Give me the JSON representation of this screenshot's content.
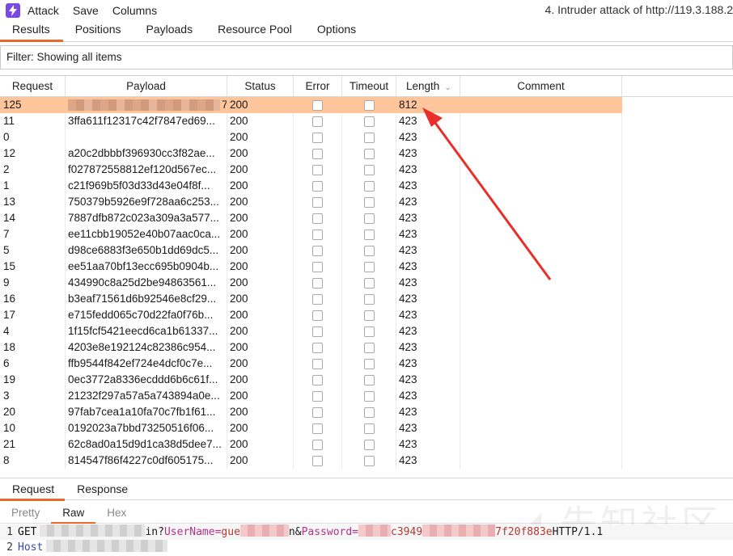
{
  "menu": {
    "items": [
      "Attack",
      "Save",
      "Columns"
    ],
    "window_title": "4. Intruder attack of http://119.3.188.2"
  },
  "tabs": [
    "Results",
    "Positions",
    "Payloads",
    "Resource Pool",
    "Options"
  ],
  "filter": {
    "text": "Filter: Showing all items"
  },
  "table": {
    "columns": [
      "Request",
      "Payload",
      "Status",
      "Error",
      "Timeout",
      "Length",
      "Comment"
    ],
    "rows": [
      {
        "request": "125",
        "payload": "7...",
        "status": "200",
        "length": "812",
        "selected": true
      },
      {
        "request": "11",
        "payload": "3ffa611f12317c42f7847ed69...",
        "status": "200",
        "length": "423"
      },
      {
        "request": "0",
        "payload": "",
        "status": "200",
        "length": "423"
      },
      {
        "request": "12",
        "payload": "a20c2dbbbf396930cc3f82ae...",
        "status": "200",
        "length": "423"
      },
      {
        "request": "2",
        "payload": "f027872558812ef120d567ec...",
        "status": "200",
        "length": "423"
      },
      {
        "request": "1",
        "payload": "c21f969b5f03d33d43e04f8f...",
        "status": "200",
        "length": "423"
      },
      {
        "request": "13",
        "payload": "750379b5926e9f728aa6c253...",
        "status": "200",
        "length": "423"
      },
      {
        "request": "14",
        "payload": "7887dfb872c023a309a3a577...",
        "status": "200",
        "length": "423"
      },
      {
        "request": "7",
        "payload": "ee11cbb19052e40b07aac0ca...",
        "status": "200",
        "length": "423"
      },
      {
        "request": "5",
        "payload": "d98ce6883f3e650b1dd69dc5...",
        "status": "200",
        "length": "423"
      },
      {
        "request": "15",
        "payload": "ee51aa70bf13ecc695b0904b...",
        "status": "200",
        "length": "423"
      },
      {
        "request": "9",
        "payload": "434990c8a25d2be94863561...",
        "status": "200",
        "length": "423"
      },
      {
        "request": "16",
        "payload": "b3eaf71561d6b92546e8cf29...",
        "status": "200",
        "length": "423"
      },
      {
        "request": "17",
        "payload": "e715fedd065c70d22fa0f76b...",
        "status": "200",
        "length": "423"
      },
      {
        "request": "4",
        "payload": "1f15fcf5421eecd6ca1b61337...",
        "status": "200",
        "length": "423"
      },
      {
        "request": "18",
        "payload": "4203e8e192124c82386c954...",
        "status": "200",
        "length": "423"
      },
      {
        "request": "6",
        "payload": "ffb9544f842ef724e4dcf0c7e...",
        "status": "200",
        "length": "423"
      },
      {
        "request": "19",
        "payload": "0ec3772a8336ecddd6b6c61f...",
        "status": "200",
        "length": "423"
      },
      {
        "request": "3",
        "payload": "21232f297a57a5a743894a0e...",
        "status": "200",
        "length": "423"
      },
      {
        "request": "20",
        "payload": "97fab7cea1a10fa70c7fb1f61...",
        "status": "200",
        "length": "423"
      },
      {
        "request": "10",
        "payload": "0192023a7bbd73250516f06...",
        "status": "200",
        "length": "423"
      },
      {
        "request": "21",
        "payload": "62c8ad0a15d9d1ca38d5dee7...",
        "status": "200",
        "length": "423"
      },
      {
        "request": "8",
        "payload": "814547f86f4227c0df605175...",
        "status": "200",
        "length": "423"
      }
    ]
  },
  "bottom_tabs": [
    "Request",
    "Response"
  ],
  "view_tabs": [
    "Pretty",
    "Raw",
    "Hex"
  ],
  "code": {
    "line1_no": "1",
    "line1_get": "GET",
    "line1_path_tail": "in?",
    "line1_user_key": "UserName=",
    "line1_user_val": "gue",
    "line1_pass_sep": "n&",
    "line1_pass_key": "Password=",
    "line1_pass_frag": "c3949",
    "line1_tail_hash": "7f20f883e",
    "line1_proto": " HTTP/1.1",
    "line2_no": "2",
    "line2_key": "Host"
  },
  "colors": {
    "accent": "#e8692a",
    "selected_row": "#ffc59b",
    "annotation_arrow": "#e8302a"
  }
}
